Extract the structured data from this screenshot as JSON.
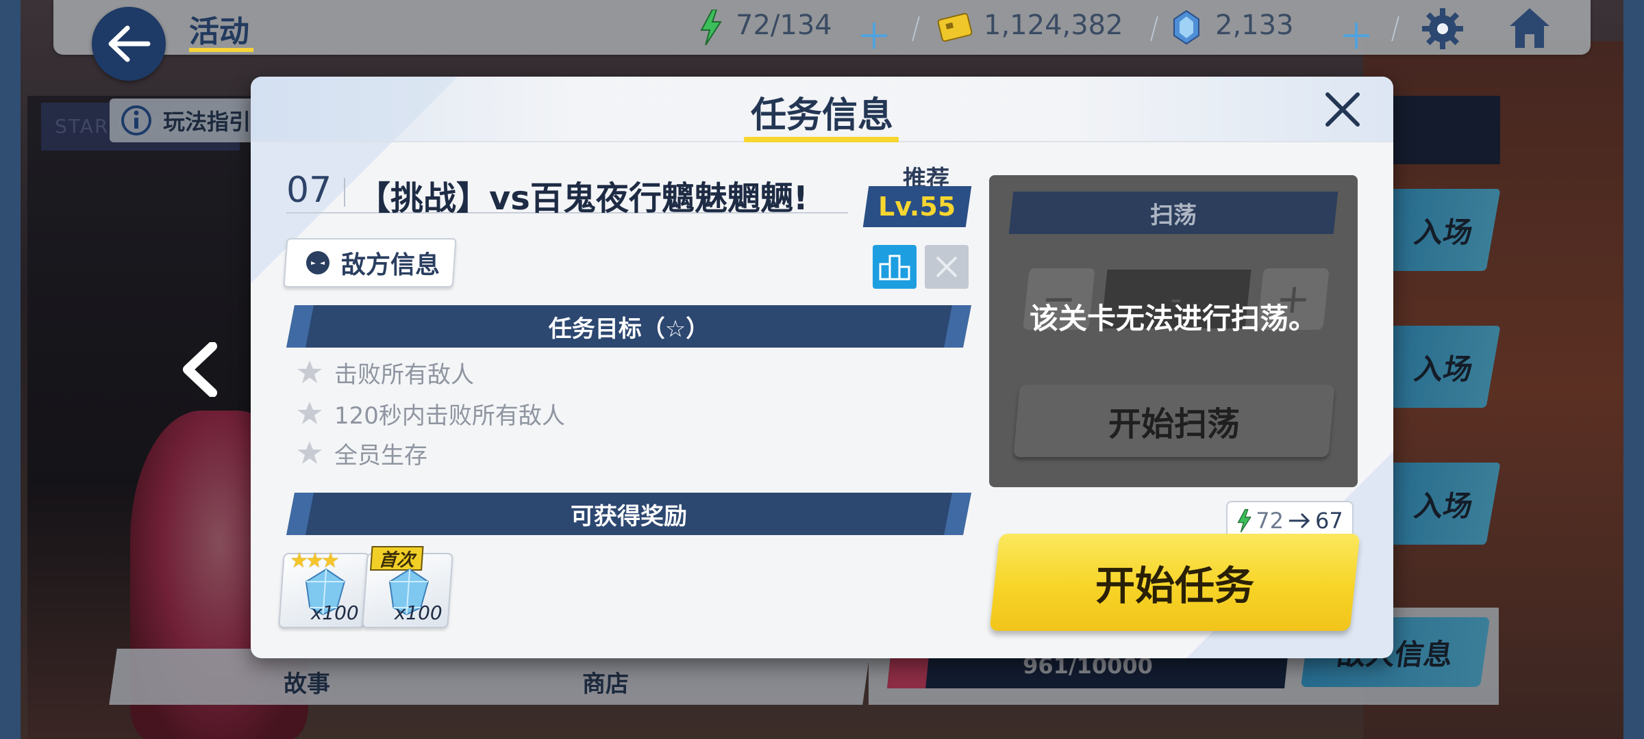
{
  "topbar": {
    "title": "活动",
    "ap": "72/134",
    "credits": "1,124,382",
    "gems": "2,133"
  },
  "background": {
    "guide_label": "玩法指引",
    "shop_sign": "STAR COFFEE",
    "bottom_tabs": [
      "故事",
      "商店"
    ],
    "right_buttons": [
      "入场",
      "入场",
      "入场"
    ],
    "progress_text": "961/10000",
    "progress_value": 0.0961,
    "boss_info_button": "敌人信息"
  },
  "dialog": {
    "title": "任务信息",
    "stage_number": "07",
    "stage_name": "【挑战】vs百鬼夜行魑魅魍魉!",
    "recommend_label": "推荐",
    "recommend_level": "Lv.55",
    "enemy_info_button": "敌方信息",
    "objectives_header": "任务目标（☆）",
    "objectives": [
      "击败所有敌人",
      "120秒内击败所有敌人",
      "全员生存"
    ],
    "rewards_header": "可获得奖励",
    "rewards": [
      {
        "count": "x100",
        "tag": "★★★"
      },
      {
        "count": "x100",
        "tag": "首次"
      }
    ]
  },
  "sweep": {
    "header": "扫荡",
    "minus": "−",
    "value": "-",
    "plus": "+",
    "message": "该关卡无法进行扫荡。",
    "start_label": "开始扫荡"
  },
  "start": {
    "ap_from": "72",
    "ap_to": "67",
    "label": "开始任务"
  },
  "colors": {
    "accent_yellow": "#f7d630",
    "navy": "#2c4770",
    "button_blue": "#1d9ee0"
  }
}
